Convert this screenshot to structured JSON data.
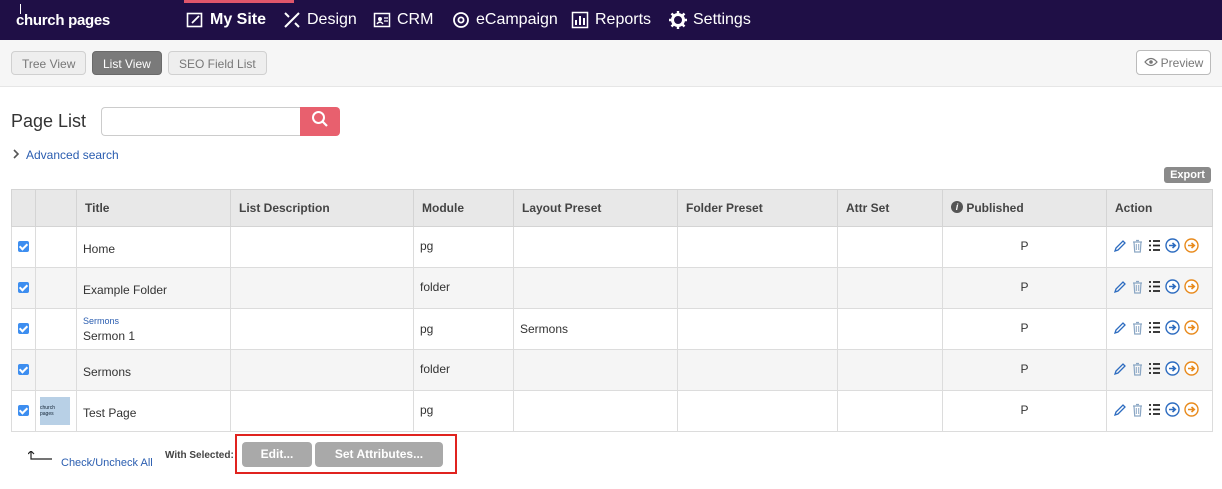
{
  "brand": {
    "logo_text": "church pages"
  },
  "nav": {
    "items": [
      {
        "label": "My Site",
        "icon": "site-icon",
        "active": true
      },
      {
        "label": "Design",
        "icon": "design-icon"
      },
      {
        "label": "CRM",
        "icon": "crm-icon"
      },
      {
        "label": "eCampaign",
        "icon": "at-icon"
      },
      {
        "label": "Reports",
        "icon": "reports-icon"
      },
      {
        "label": "Settings",
        "icon": "gear-icon"
      }
    ]
  },
  "view_tabs": [
    {
      "label": "Tree View"
    },
    {
      "label": "List View",
      "active": true
    },
    {
      "label": "SEO Field List"
    }
  ],
  "preview_label": "Preview",
  "page_title": "Page List",
  "search": {
    "value": "",
    "placeholder": ""
  },
  "advanced_search_label": "Advanced search",
  "export_label": "Export",
  "table": {
    "columns": [
      "",
      "",
      "Title",
      "List Description",
      "Module",
      "Layout Preset",
      "Folder Preset",
      "Attr Set",
      "Published",
      "Action"
    ],
    "rows": [
      {
        "checked": true,
        "thumb": "",
        "parent": "",
        "title": "Home",
        "description": "",
        "module": "pg",
        "layout": "",
        "folder": "",
        "attr": "",
        "published": "P"
      },
      {
        "checked": true,
        "thumb": "",
        "parent": "",
        "title": "Example Folder",
        "description": "",
        "module": "folder",
        "layout": "",
        "folder": "",
        "attr": "",
        "published": "P"
      },
      {
        "checked": true,
        "thumb": "",
        "parent": "Sermons",
        "title": "Sermon 1",
        "description": "",
        "module": "pg",
        "layout": "Sermons",
        "folder": "",
        "attr": "",
        "published": "P"
      },
      {
        "checked": true,
        "thumb": "",
        "parent": "",
        "title": "Sermons",
        "description": "",
        "module": "folder",
        "layout": "",
        "folder": "",
        "attr": "",
        "published": "P"
      },
      {
        "checked": true,
        "thumb": "church pages",
        "parent": "",
        "title": "Test Page",
        "description": "",
        "module": "pg",
        "layout": "",
        "folder": "",
        "attr": "",
        "published": "P"
      }
    ]
  },
  "footer": {
    "check_all_label": "Check/Uncheck All",
    "with_selected_label": "With Selected:",
    "edit_label": "Edit...",
    "set_attributes_label": "Set Attributes..."
  },
  "colors": {
    "topbar": "#1f0f46",
    "accent": "#e8606e",
    "link": "#2a5db0",
    "highlight_box": "#e0231f"
  }
}
